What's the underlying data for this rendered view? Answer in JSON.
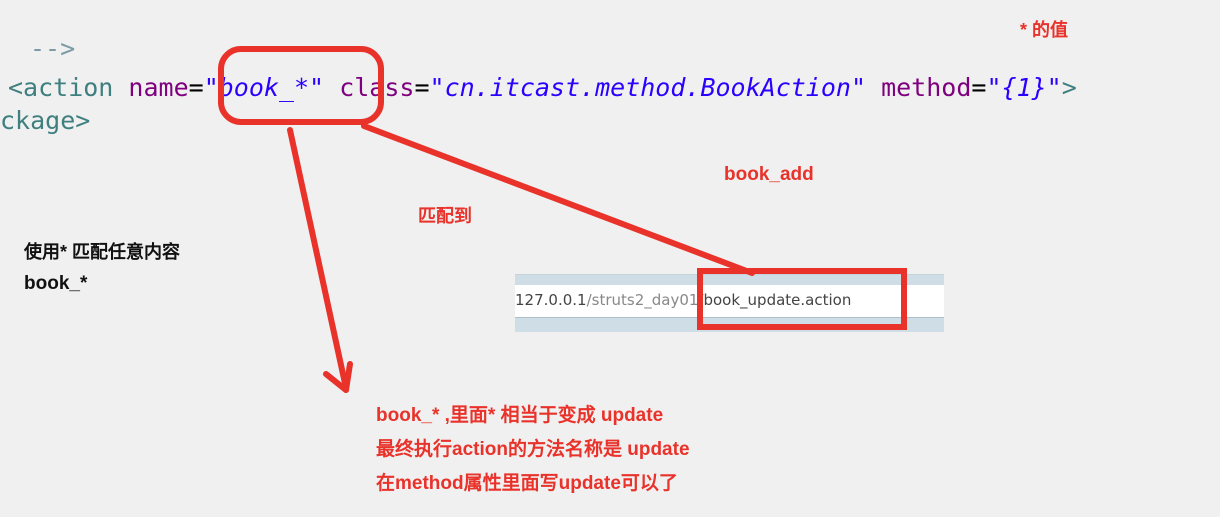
{
  "code": {
    "comment": "-->",
    "line1": {
      "open": "<action",
      "name_attr": "name",
      "name_val": "\"book_*\"",
      "class_attr": "class",
      "class_val": "\"cn.itcast.method.BookAction\"",
      "method_attr": "method",
      "method_val": "\"{1}\"",
      "close": ">"
    },
    "line2": "ckage>"
  },
  "annotations": {
    "star_value": "* 的值",
    "book_add": "book_add",
    "matched_to": "匹配到",
    "use_star": "使用* 匹配任意内容",
    "book_star": "book_*"
  },
  "note_lines": [
    "book_* ,里面* 相当于变成 update",
    "最终执行action的方法名称是 update",
    "在method属性里面写update可以了"
  ],
  "url": {
    "host": "127.0.0.1",
    "path_dim": "/struts2_day01",
    "action": "/book_update.action"
  },
  "colors": {
    "annotation_red": "#e8322a",
    "tag": "#3f7f7f",
    "attribute": "#7f007f",
    "value": "#2a00ff"
  }
}
